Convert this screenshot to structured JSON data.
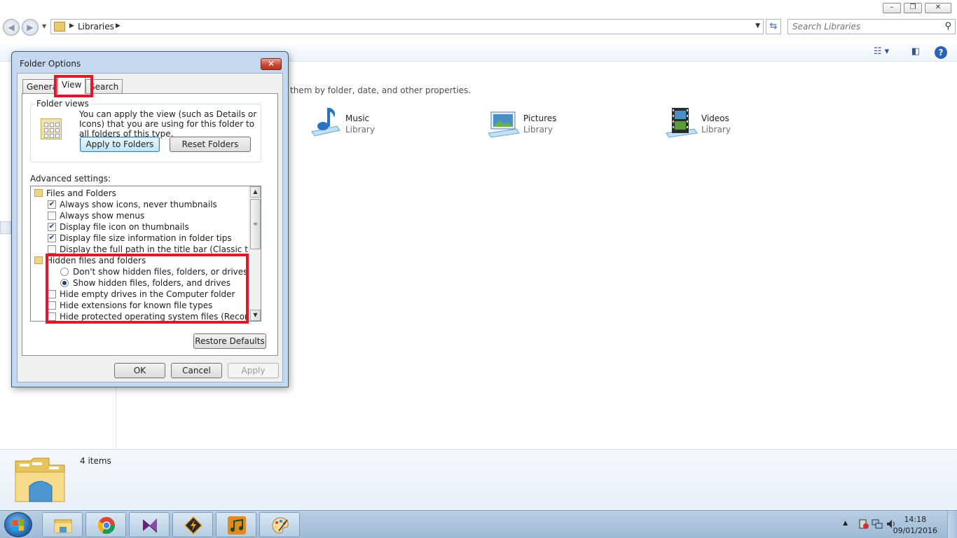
{
  "explorer": {
    "address": {
      "crumb": "Libraries"
    },
    "search": {
      "placeholder": "Search Libraries"
    },
    "library_description": "them by folder, date, and other properties.",
    "libraries": [
      {
        "name": "Music",
        "type": "Library"
      },
      {
        "name": "Pictures",
        "type": "Library"
      },
      {
        "name": "Videos",
        "type": "Library"
      }
    ],
    "details": {
      "count": "4 items"
    }
  },
  "dialog": {
    "title": "Folder Options",
    "close_glyph": "✕",
    "tabs": [
      "General",
      "View",
      "Search"
    ],
    "active_tab": "View",
    "folder_views": {
      "legend": "Folder views",
      "text": "You can apply the view (such as Details or Icons) that you are using for this folder to all folders of this type.",
      "apply_button": "Apply to Folders",
      "reset_button": "Reset Folders"
    },
    "advanced_label": "Advanced settings:",
    "settings": [
      {
        "label": "Files and Folders",
        "kind": "folder"
      },
      {
        "label": "Always show icons, never thumbnails",
        "kind": "checkbox",
        "checked": true
      },
      {
        "label": "Always show menus",
        "kind": "checkbox",
        "checked": false
      },
      {
        "label": "Display file icon on thumbnails",
        "kind": "checkbox",
        "checked": true
      },
      {
        "label": "Display file size information in folder tips",
        "kind": "checkbox",
        "checked": true
      },
      {
        "label": "Display the full path in the title bar (Classic theme only)",
        "kind": "checkbox",
        "checked": false
      },
      {
        "label": "Hidden files and folders",
        "kind": "folder"
      },
      {
        "label": "Don't show hidden files, folders, or drives",
        "kind": "radio",
        "checked": false
      },
      {
        "label": "Show hidden files, folders, and drives",
        "kind": "radio",
        "checked": true
      },
      {
        "label": "Hide empty drives in the Computer folder",
        "kind": "checkbox",
        "checked": false
      },
      {
        "label": "Hide extensions for known file types",
        "kind": "checkbox",
        "checked": false
      },
      {
        "label": "Hide protected operating system files (Recommended)",
        "kind": "checkbox",
        "checked": false
      }
    ],
    "restore_button": "Restore Defaults",
    "ok_button": "OK",
    "cancel_button": "Cancel",
    "apply_button": "Apply"
  },
  "taskbar": {
    "pinned": [
      "windows-explorer",
      "google-chrome",
      "visual-studio",
      "winamp",
      "media-player",
      "paint"
    ],
    "clock_time": "14:18",
    "clock_date": "09/01/2016"
  },
  "colors": {
    "highlight": "#e2172b",
    "dialog_frame": "#c4d8ef",
    "taskbar": "#b8cfe4"
  }
}
